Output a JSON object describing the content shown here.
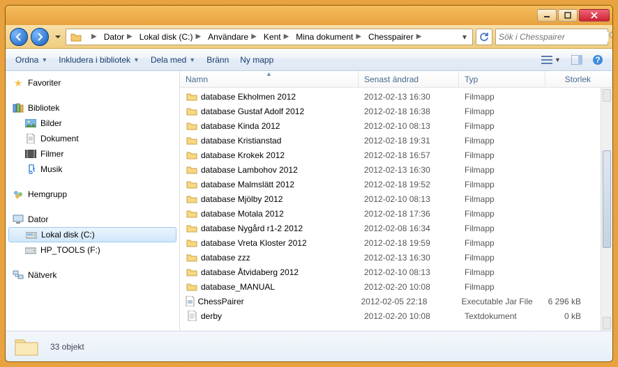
{
  "breadcrumbs": [
    "Dator",
    "Lokal disk (C:)",
    "Användare",
    "Kent",
    "Mina dokument",
    "Chesspairer"
  ],
  "search_placeholder": "Sök i Chesspairer",
  "toolbar": {
    "organize": "Ordna",
    "include": "Inkludera i bibliotek",
    "share": "Dela med",
    "burn": "Bränn",
    "newfolder": "Ny mapp"
  },
  "sidebar": {
    "favorites": "Favoriter",
    "libraries": "Bibliotek",
    "pictures": "Bilder",
    "documents": "Dokument",
    "videos": "Filmer",
    "music": "Musik",
    "homegroup": "Hemgrupp",
    "computer": "Dator",
    "localdisk": "Lokal disk (C:)",
    "hptools": "HP_TOOLS (F:)",
    "network": "Nätverk"
  },
  "columns": {
    "name": "Namn",
    "modified": "Senast ändrad",
    "type": "Typ",
    "size": "Storlek"
  },
  "files": [
    {
      "name": "database Ekholmen 2012",
      "mod": "2012-02-13 16:30",
      "type": "Filmapp",
      "size": "",
      "kind": "folder"
    },
    {
      "name": "database Gustaf Adolf 2012",
      "mod": "2012-02-18 16:38",
      "type": "Filmapp",
      "size": "",
      "kind": "folder"
    },
    {
      "name": "database Kinda 2012",
      "mod": "2012-02-10 08:13",
      "type": "Filmapp",
      "size": "",
      "kind": "folder"
    },
    {
      "name": "database Kristianstad",
      "mod": "2012-02-18 19:31",
      "type": "Filmapp",
      "size": "",
      "kind": "folder"
    },
    {
      "name": "database Krokek 2012",
      "mod": "2012-02-18 16:57",
      "type": "Filmapp",
      "size": "",
      "kind": "folder"
    },
    {
      "name": "database Lambohov 2012",
      "mod": "2012-02-13 16:30",
      "type": "Filmapp",
      "size": "",
      "kind": "folder"
    },
    {
      "name": "database Malmslätt 2012",
      "mod": "2012-02-18 19:52",
      "type": "Filmapp",
      "size": "",
      "kind": "folder"
    },
    {
      "name": "database Mjölby 2012",
      "mod": "2012-02-10 08:13",
      "type": "Filmapp",
      "size": "",
      "kind": "folder"
    },
    {
      "name": "database Motala 2012",
      "mod": "2012-02-18 17:36",
      "type": "Filmapp",
      "size": "",
      "kind": "folder"
    },
    {
      "name": "database Nygård r1-2 2012",
      "mod": "2012-02-08 16:34",
      "type": "Filmapp",
      "size": "",
      "kind": "folder"
    },
    {
      "name": "database Vreta Kloster 2012",
      "mod": "2012-02-18 19:59",
      "type": "Filmapp",
      "size": "",
      "kind": "folder"
    },
    {
      "name": "database zzz",
      "mod": "2012-02-13 16:30",
      "type": "Filmapp",
      "size": "",
      "kind": "folder"
    },
    {
      "name": "database Åtvidaberg 2012",
      "mod": "2012-02-10 08:13",
      "type": "Filmapp",
      "size": "",
      "kind": "folder"
    },
    {
      "name": "database_MANUAL",
      "mod": "2012-02-20 10:08",
      "type": "Filmapp",
      "size": "",
      "kind": "folder"
    },
    {
      "name": "ChessPairer",
      "mod": "2012-02-05 22:18",
      "type": "Executable Jar File",
      "size": "6 296 kB",
      "kind": "jar"
    },
    {
      "name": "derby",
      "mod": "2012-02-20 10:08",
      "type": "Textdokument",
      "size": "0 kB",
      "kind": "text"
    }
  ],
  "status": "33 objekt"
}
